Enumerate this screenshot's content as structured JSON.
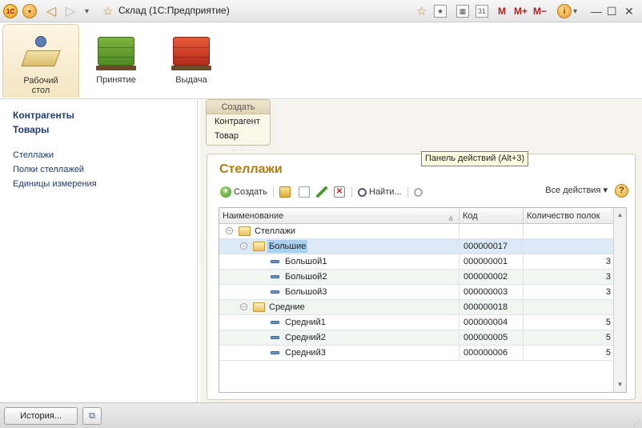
{
  "titlebar": {
    "title": "Склад  (1С:Предприятие)",
    "logo_text": "1С",
    "m_label": "M",
    "m_plus_label": "M+",
    "m_minus_label": "M−",
    "calendar_day": "31"
  },
  "sections": [
    {
      "label": "Рабочий стол",
      "icon": "desktop-icon"
    },
    {
      "label": "Принятие",
      "icon": "green-pallet-icon"
    },
    {
      "label": "Выдача",
      "icon": "red-pallet-icon"
    }
  ],
  "leftnav": {
    "bold_items": [
      "Контрагенты",
      "Товары"
    ],
    "links": [
      "Стеллажи",
      "Полки стеллажей",
      "Единицы измерения"
    ]
  },
  "create_panel": {
    "title": "Создать",
    "items": [
      "Контрагент",
      "Товар"
    ]
  },
  "tooltip": "Панель действий (Alt+3)",
  "form": {
    "title": "Стеллажи",
    "toolbar": {
      "create_label": "Создать",
      "find_label": "Найти...",
      "all_actions_label": "Все действия ▾",
      "help_label": "?"
    },
    "grid": {
      "columns": [
        "Наименование",
        "Код",
        "Количество полок"
      ],
      "rows": [
        {
          "name": "Стеллажи",
          "code": "",
          "qty": "",
          "kind": "root"
        },
        {
          "name": "Большие",
          "code": "000000017",
          "qty": "",
          "kind": "group"
        },
        {
          "name": "Большой1",
          "code": "000000001",
          "qty": "3",
          "kind": "item"
        },
        {
          "name": "Большой2",
          "code": "000000002",
          "qty": "3",
          "kind": "item"
        },
        {
          "name": "Большой3",
          "code": "000000003",
          "qty": "3",
          "kind": "item"
        },
        {
          "name": "Средние",
          "code": "000000018",
          "qty": "",
          "kind": "group"
        },
        {
          "name": "Средний1",
          "code": "000000004",
          "qty": "5",
          "kind": "item"
        },
        {
          "name": "Средний2",
          "code": "000000005",
          "qty": "5",
          "kind": "item"
        },
        {
          "name": "Средний3",
          "code": "000000006",
          "qty": "5",
          "kind": "item"
        }
      ],
      "selected_row_index": 1
    }
  },
  "bottombar": {
    "history_label": "История..."
  },
  "colors": {
    "accent_title": "#b07c10",
    "nav_link": "#1f3c6e",
    "selection": "#a9cfee"
  }
}
